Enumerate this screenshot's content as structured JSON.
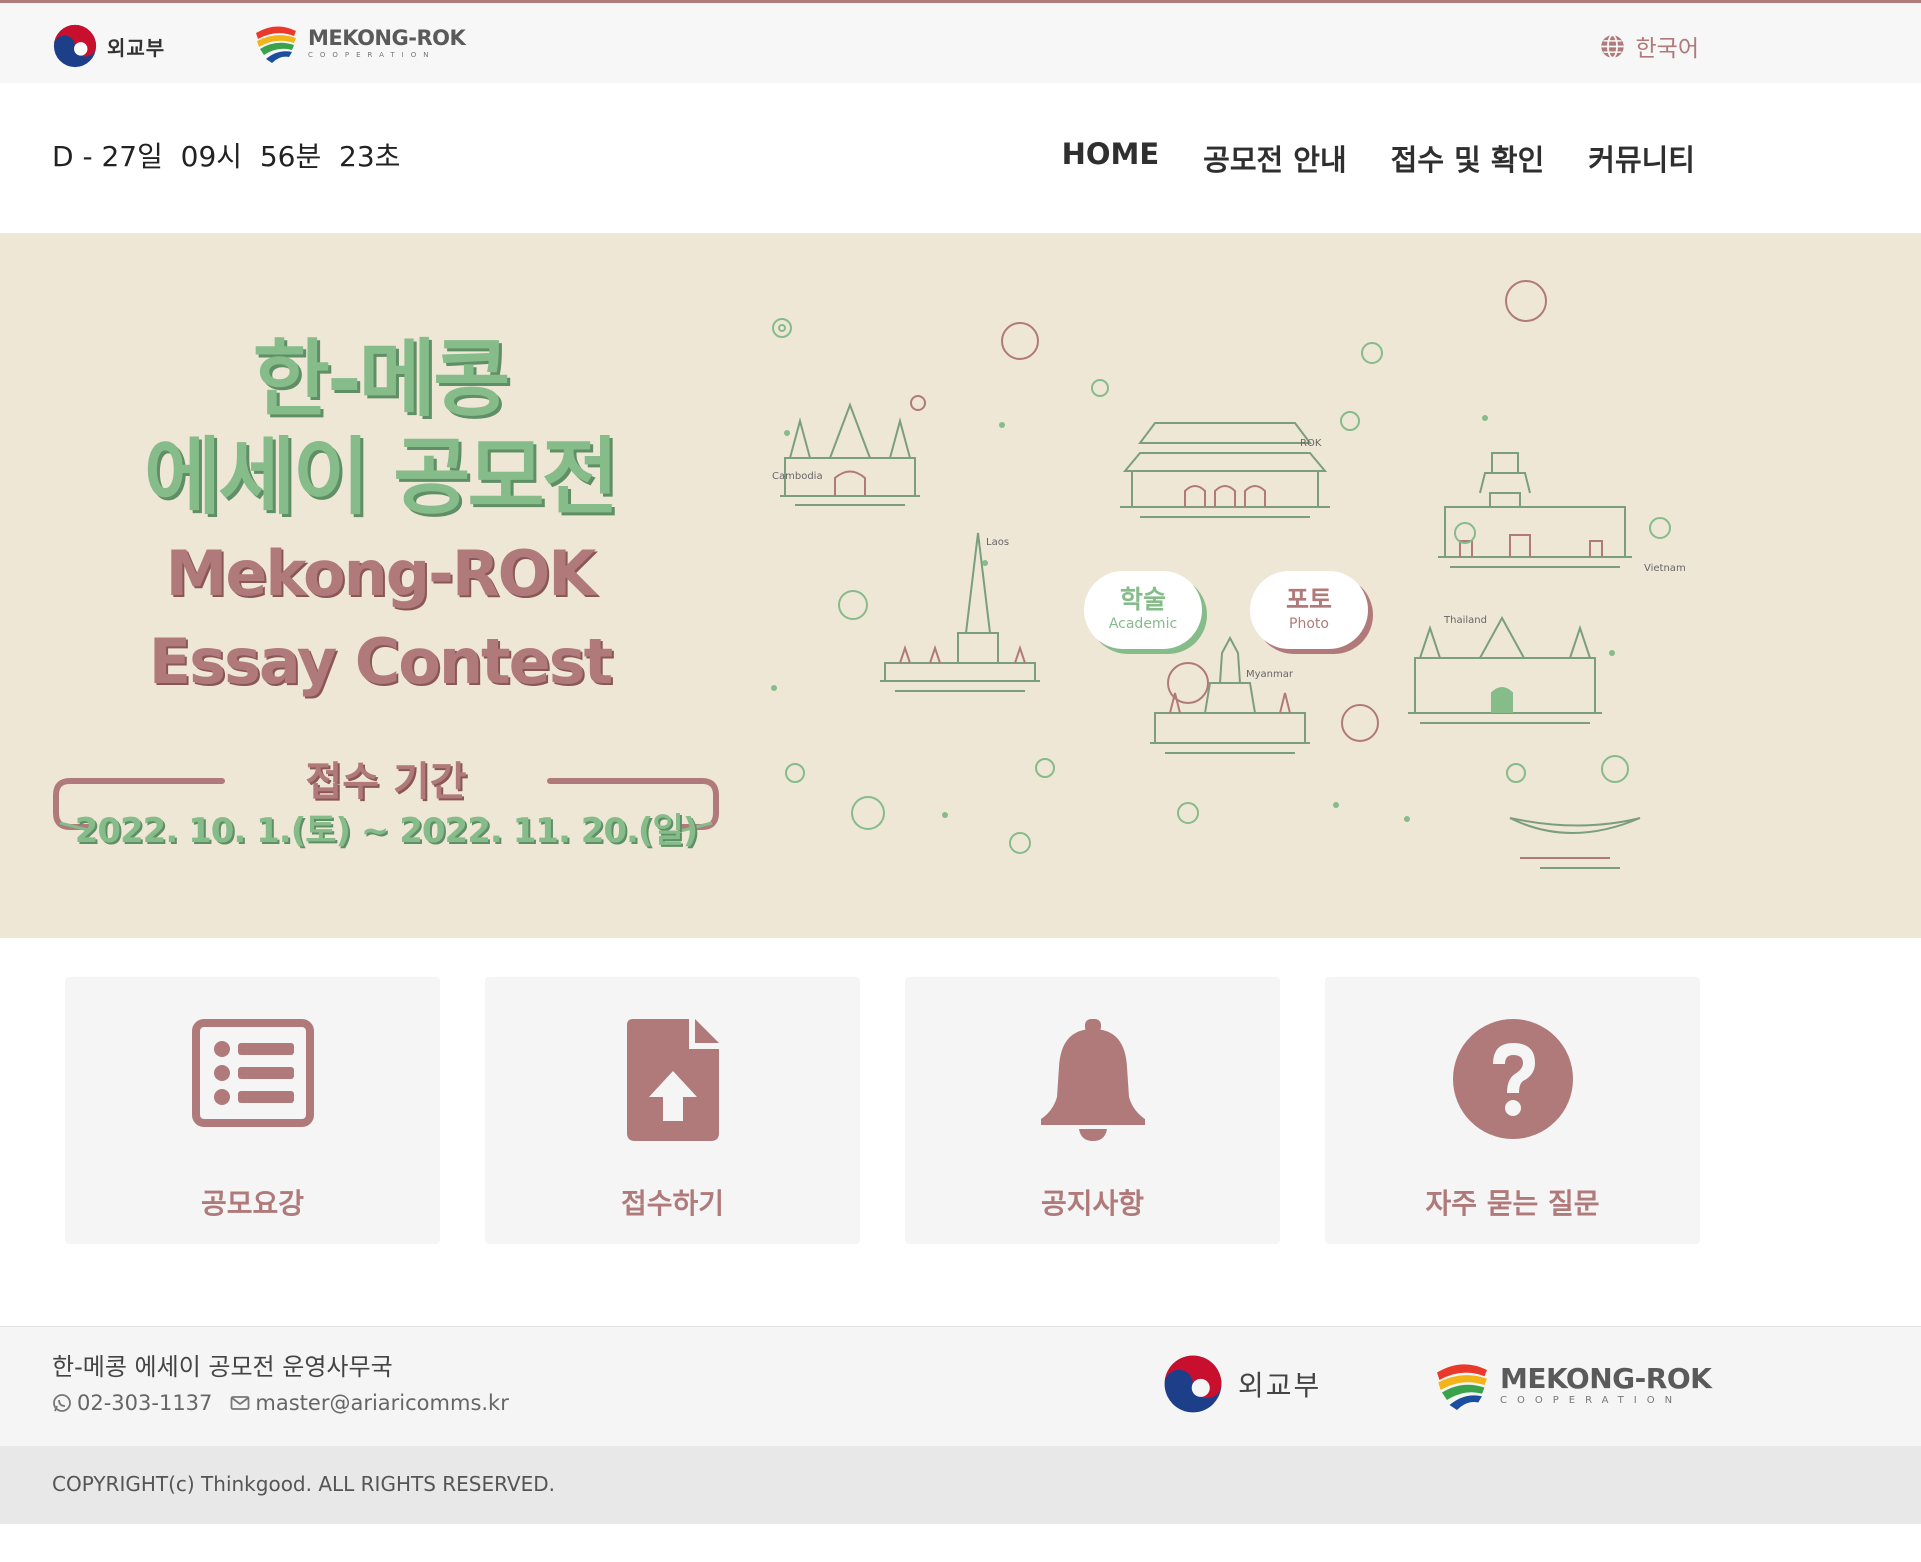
{
  "top_bar": {
    "mofa_logo_text": "외교부",
    "mekong_logo_name": "MEKONG-ROK",
    "mekong_logo_sub": "COOPERATION",
    "language": "한국어",
    "language_icon": "globe-icon"
  },
  "header": {
    "countdown": "D - 27일  09시  56분  23초",
    "nav": [
      "HOME",
      "공모전 안내",
      "접수 및 확인",
      "커뮤니티"
    ]
  },
  "hero": {
    "title_kr_line1": "한-메콩",
    "title_kr_line2": "에세이 공모전",
    "title_en_line1": "Mekong-ROK",
    "title_en_line2": "Essay Contest",
    "period_label": "접수 기간",
    "period_dates": "2022. 10. 1.(토) ~ 2022. 11. 20.(일)",
    "academic_kr": "학술",
    "academic_en": "Academic",
    "photo_kr": "포토",
    "photo_en": "Photo",
    "countries": [
      "Cambodia",
      "Laos",
      "ROK",
      "Myanmar",
      "Thailand",
      "Vietnam"
    ]
  },
  "quick_menu": [
    {
      "label": "공모요강",
      "icon": "list-icon"
    },
    {
      "label": "접수하기",
      "icon": "file-upload-icon"
    },
    {
      "label": "공지사항",
      "icon": "bell-icon"
    },
    {
      "label": "자주 묻는 질문",
      "icon": "question-circle-icon"
    }
  ],
  "footer": {
    "office": "한-메콩 에세이 공모전 운영사무국",
    "phone": "02-303-1137",
    "email": "master@ariaricomms.kr",
    "mofa_logo_text": "외교부",
    "mekong_logo_name": "MEKONG-ROK",
    "mekong_logo_sub": "COOPERATION",
    "copyright": "COPYRIGHT(c) Thinkgood. ALL RIGHTS RESERVED."
  },
  "colors": {
    "accent_rose": "#b07a7a",
    "accent_green": "#86bb8a",
    "hero_bg": "#efe7d6"
  }
}
